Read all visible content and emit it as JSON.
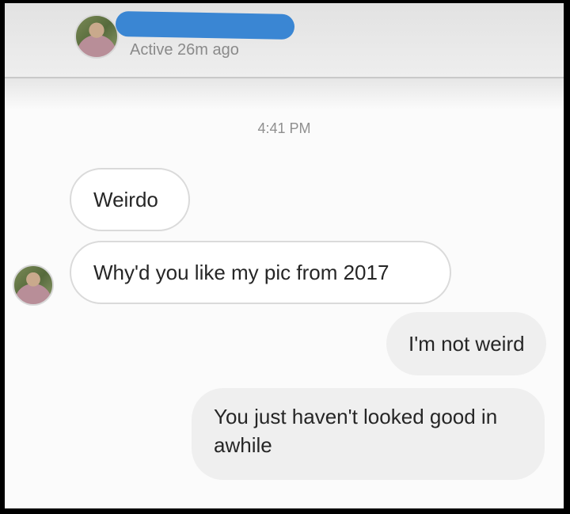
{
  "header": {
    "status": "Active 26m ago"
  },
  "conversation": {
    "timestamp": "4:41 PM",
    "messages": [
      {
        "direction": "received",
        "text": "Weirdo"
      },
      {
        "direction": "received",
        "text": "Why'd you like my pic from 2017"
      },
      {
        "direction": "sent",
        "text": "I'm not weird"
      },
      {
        "direction": "sent",
        "text": "You just haven't looked good in awhile"
      }
    ]
  },
  "colors": {
    "redaction": "#3a86d3",
    "received_bubble": "#ffffff",
    "sent_bubble": "#efefef"
  }
}
